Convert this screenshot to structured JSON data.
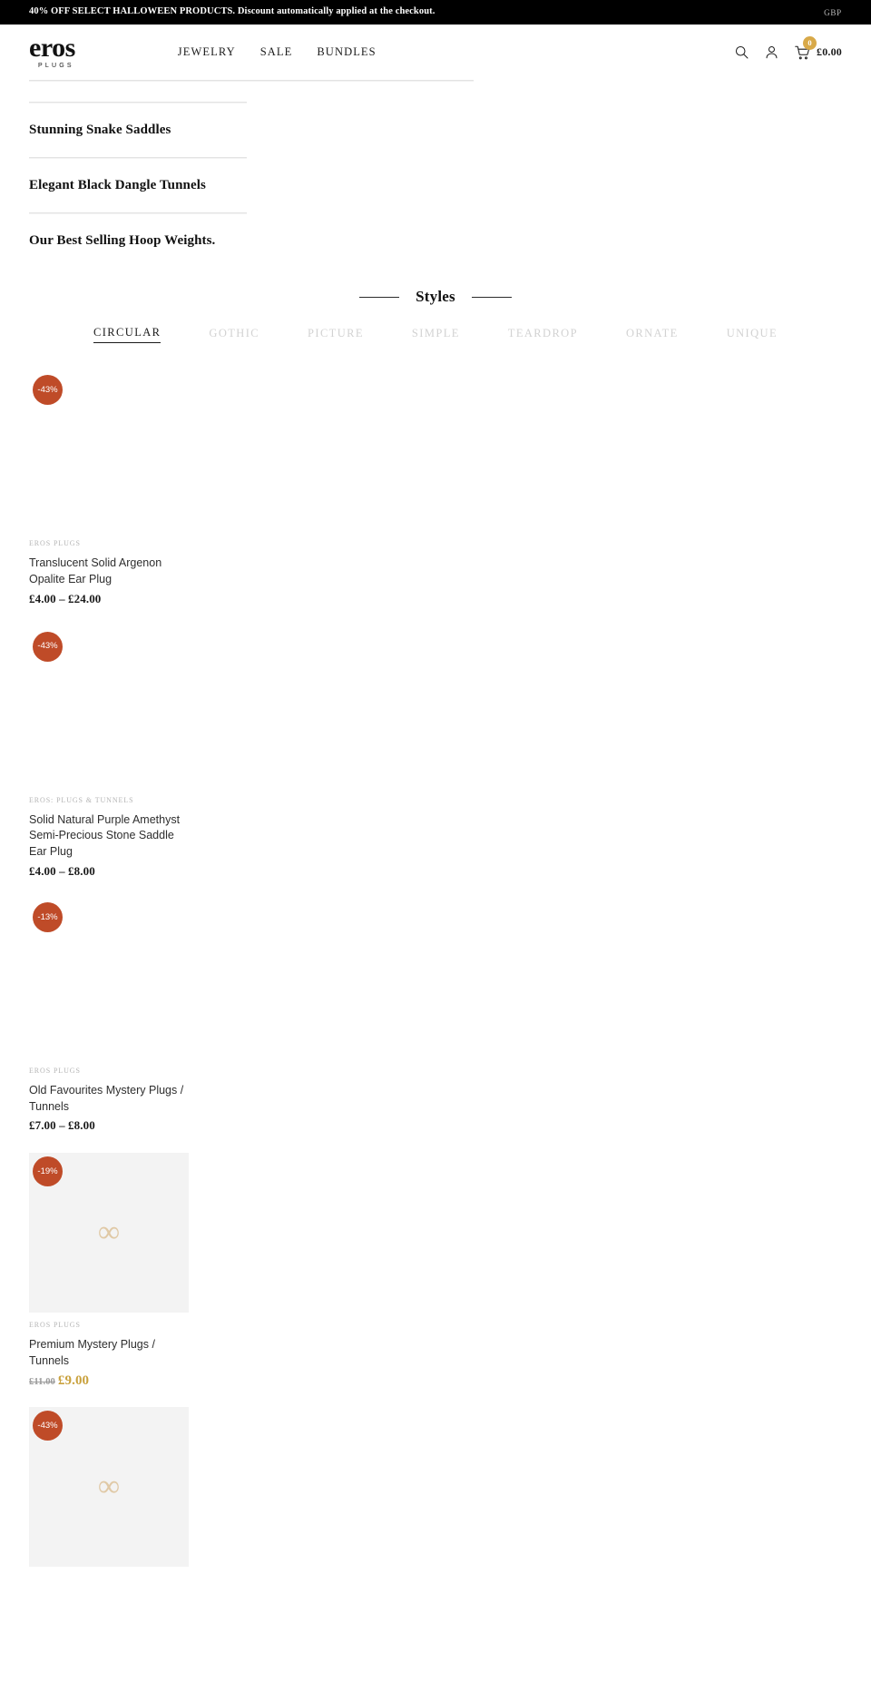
{
  "announcement": {
    "text": "40% OFF SELECT HALLOWEEN PRODUCTS. Discount automatically applied at the checkout.",
    "currency": "GBP"
  },
  "header": {
    "logo_main": "eros",
    "logo_sub": "PLUGS",
    "nav": [
      {
        "label": "JEWELRY"
      },
      {
        "label": "SALE"
      },
      {
        "label": "BUNDLES"
      }
    ],
    "cart_count": "0",
    "cart_total": "£0.00"
  },
  "collection_links": [
    {
      "title": "Stunning Snake Saddles"
    },
    {
      "title": "Elegant Black Dangle Tunnels"
    },
    {
      "title": "Our Best Selling Hoop Weights."
    }
  ],
  "styles_section": {
    "title": "Styles",
    "tabs": [
      {
        "label": "CIRCULAR",
        "active": true
      },
      {
        "label": "GOTHIC",
        "active": false
      },
      {
        "label": "PICTURE",
        "active": false
      },
      {
        "label": "SIMPLE",
        "active": false
      },
      {
        "label": "TEARDROP",
        "active": false
      },
      {
        "label": "ORNATE",
        "active": false
      },
      {
        "label": "UNIQUE",
        "active": false
      }
    ]
  },
  "products": [
    {
      "badge": "-43%",
      "vendor": "EROS PLUGS",
      "title": "Translucent Solid Argenon Opalite Ear Plug",
      "price": "£4.00 – £24.00",
      "media": "blank"
    },
    {
      "badge": "-43%",
      "vendor": "EROS: PLUGS & TUNNELS",
      "title": "Solid Natural Purple Amethyst Semi-Precious Stone Saddle Ear Plug",
      "price": "£4.00 – £8.00",
      "media": "blank"
    },
    {
      "badge": "-13%",
      "vendor": "EROS PLUGS",
      "title": "Old Favourites Mystery Plugs / Tunnels",
      "price": "£7.00 – £8.00",
      "media": "blank"
    },
    {
      "badge": "-19%",
      "vendor": "EROS PLUGS",
      "title": "Premium Mystery Plugs / Tunnels",
      "price_compare": "£11.00",
      "price_sale": "£9.00",
      "media": "placeholder"
    },
    {
      "badge": "-43%",
      "vendor": "",
      "title": "",
      "price": "",
      "media": "placeholder"
    }
  ],
  "colors": {
    "badge": "#bf4b28",
    "sale_price": "#c9a13d",
    "cart_badge": "#d8a949",
    "announcement_bg": "#000000"
  }
}
